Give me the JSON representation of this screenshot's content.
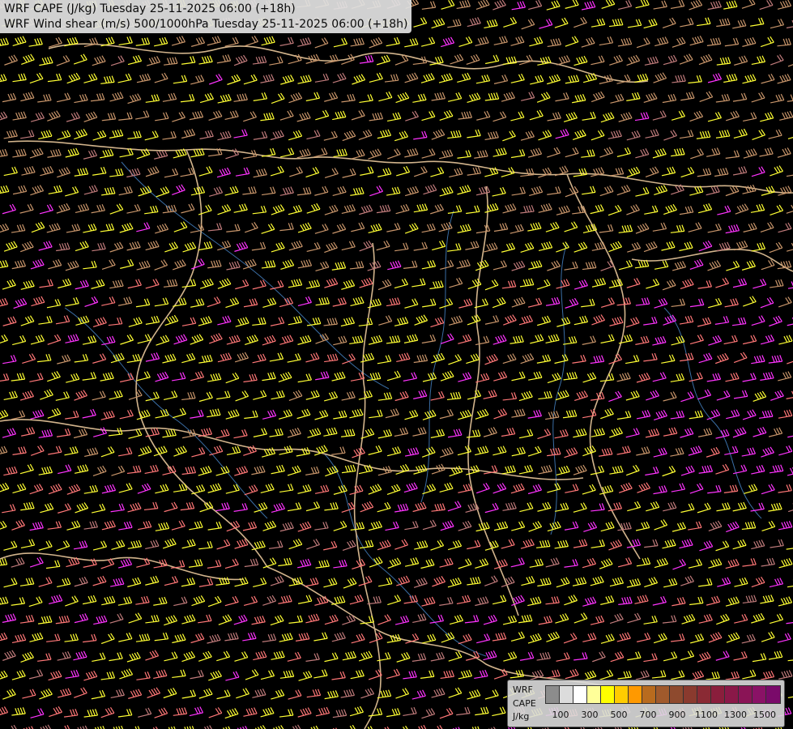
{
  "title": {
    "line1": "WRF CAPE (J/kg) Tuesday 25-11-2025 06:00 (+18h)",
    "line2": "WRF Wind shear (m/s) 500/1000hPa Tuesday 25-11-2025 06:00 (+18h)"
  },
  "legend": {
    "label_line1": "WRF",
    "label_line2": "CAPE",
    "label_line3": "J/kg",
    "colors": [
      "#8c8c8c",
      "#dcdcdc",
      "#ffffff",
      "#ffff99",
      "#ffff00",
      "#ffcc00",
      "#ff9900",
      "#b86b1e",
      "#a05a2c",
      "#8e4a2e",
      "#8a3a2e",
      "#8a2a34",
      "#8a1e3c",
      "#8a1848",
      "#8a1456",
      "#8a1266",
      "#7a0a6a"
    ],
    "ticks": [
      "100",
      "300",
      "500",
      "700",
      "900",
      "1100",
      "1300",
      "1500"
    ]
  },
  "map": {
    "background": "#000000",
    "barb_colors": {
      "low": "#c8956a",
      "light": "#ffff33",
      "medium": "#ff7777",
      "high": "#ff33ff",
      "muted": "#c07b7b"
    },
    "border_color": "#d2b48c",
    "river_color": "#3a6ea5"
  }
}
